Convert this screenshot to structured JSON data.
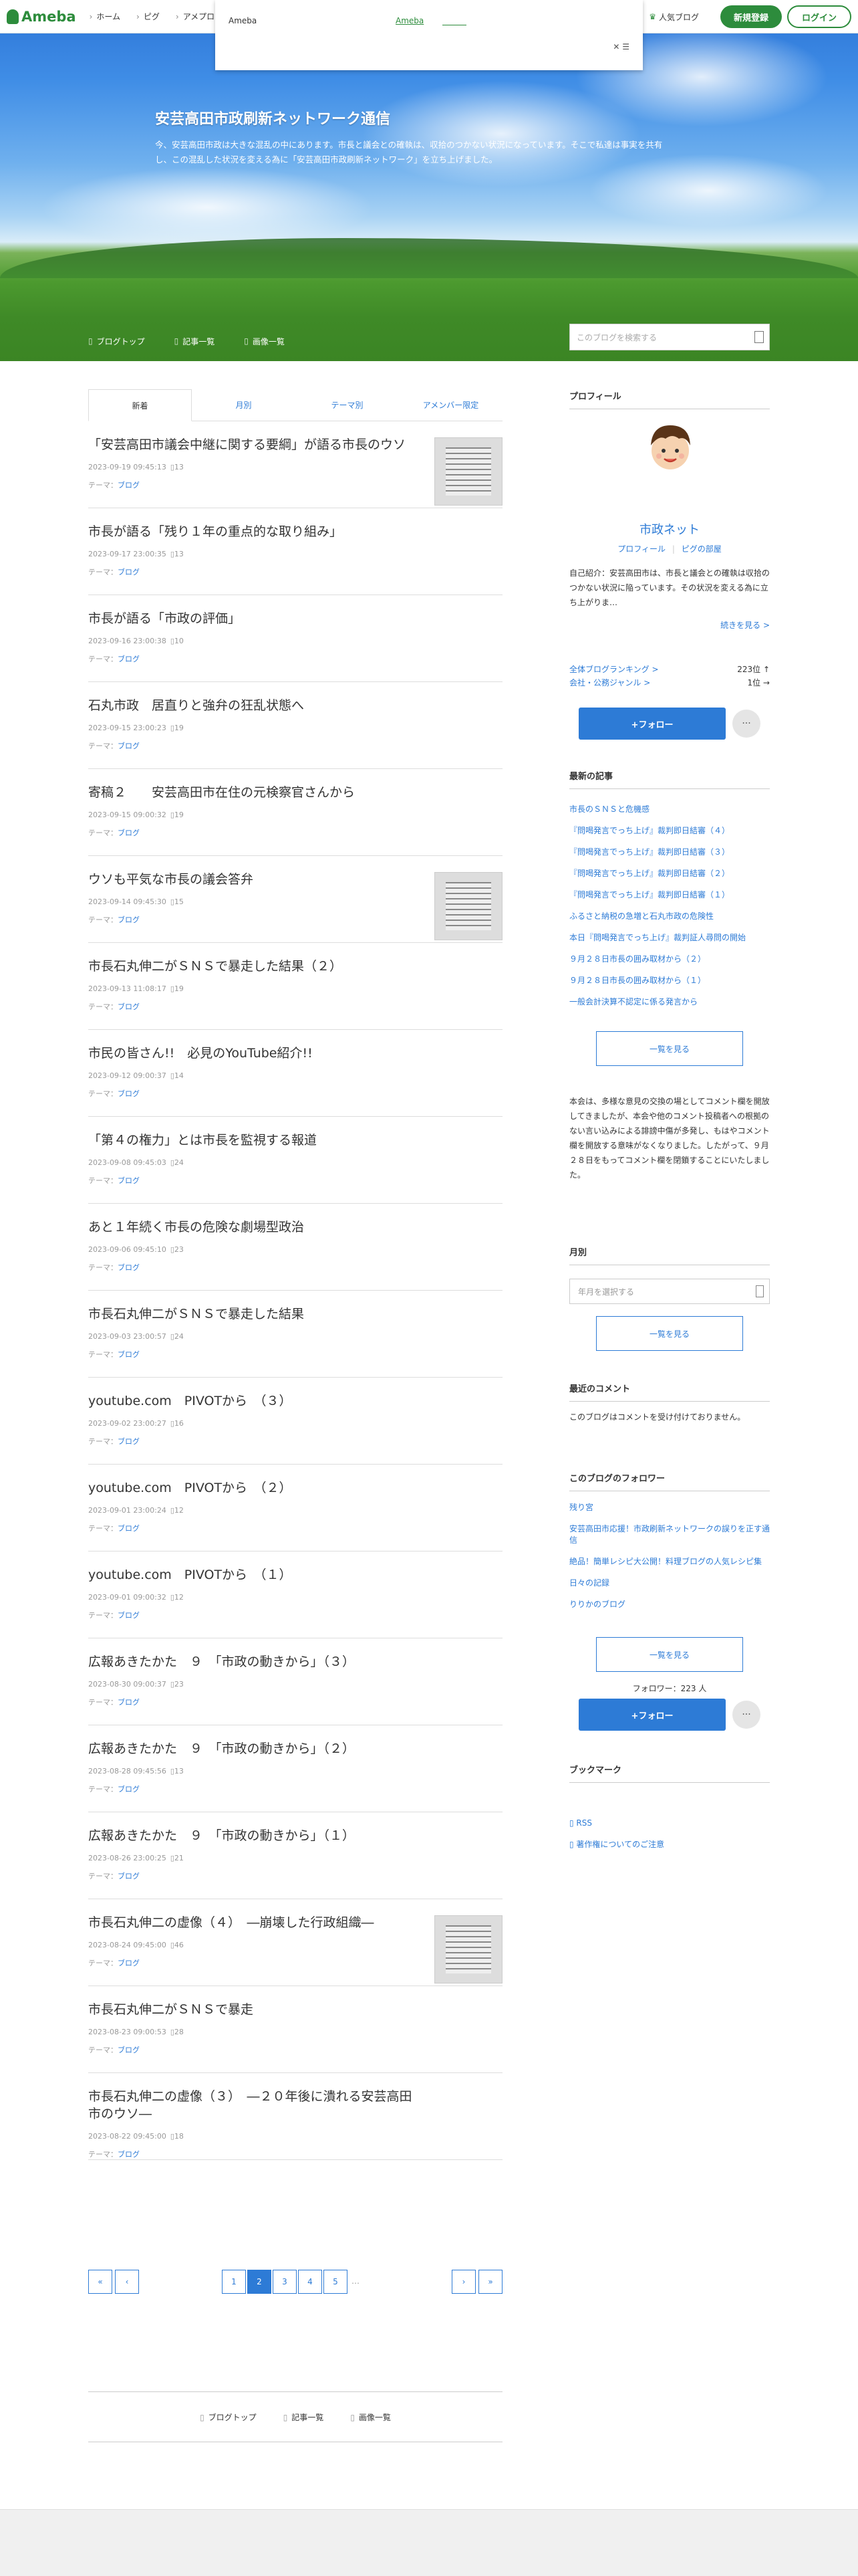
{
  "topbar": {
    "logo": "Ameba",
    "nav": [
      "ホーム",
      "ピグ",
      "アメプロ"
    ],
    "ad": {
      "label": "Ameba",
      "link": "Ameba",
      "close": "✕ ☰"
    },
    "popular_blog": "人気ブログ",
    "register": "新規登録",
    "login": "ログイン"
  },
  "header": {
    "title": "安芸高田市政刷新ネットワーク通信",
    "description": "今、安芸高田市政は大きな混乱の中にあります。市長と議会との確執は、収拾のつかない状況になっています。そこで私達は事実を共有し、この混乱した状況を変える為に「安芸高田市政刷新ネットワーク」を立ち上げました。",
    "nav": [
      "ブログトップ",
      "記事一覧",
      "画像一覧"
    ],
    "search_placeholder": "このブログを検索する"
  },
  "tabs": [
    "新着",
    "月別",
    "テーマ別",
    "アメンバー限定"
  ],
  "entries": [
    {
      "title": "「安芸高田市議会中継に関する要綱」が語る市長のウソ",
      "date": "2023-09-19 09:45:13",
      "comments": "13",
      "theme_label": "テーマ：",
      "theme": "ブログ",
      "thumb": true
    },
    {
      "title": "市長が語る「残り１年の重点的な取り組み」",
      "date": "2023-09-17 23:00:35",
      "comments": "13",
      "theme_label": "テーマ：",
      "theme": "ブログ",
      "thumb": false
    },
    {
      "title": "市長が語る「市政の評価」",
      "date": "2023-09-16 23:00:38",
      "comments": "10",
      "theme_label": "テーマ：",
      "theme": "ブログ",
      "thumb": false
    },
    {
      "title": "石丸市政　居直りと強弁の狂乱状態へ",
      "date": "2023-09-15 23:00:23",
      "comments": "19",
      "theme_label": "テーマ：",
      "theme": "ブログ",
      "thumb": false
    },
    {
      "title": "寄稿２　　安芸高田市在住の元検察官さんから",
      "date": "2023-09-15 09:00:32",
      "comments": "19",
      "theme_label": "テーマ：",
      "theme": "ブログ",
      "thumb": false
    },
    {
      "title": "ウソも平気な市長の議会答弁",
      "date": "2023-09-14 09:45:30",
      "comments": "15",
      "theme_label": "テーマ：",
      "theme": "ブログ",
      "thumb": true
    },
    {
      "title": "市長石丸伸二がＳＮＳで暴走した結果（２）",
      "date": "2023-09-13 11:08:17",
      "comments": "19",
      "theme_label": "テーマ：",
      "theme": "ブログ",
      "thumb": false
    },
    {
      "title": "市民の皆さん!!　必見のYouTube紹介!!",
      "date": "2023-09-12 09:00:37",
      "comments": "14",
      "theme_label": "テーマ：",
      "theme": "ブログ",
      "thumb": false
    },
    {
      "title": "「第４の権力」とは市長を監視する報道",
      "date": "2023-09-08 09:45:03",
      "comments": "24",
      "theme_label": "テーマ：",
      "theme": "ブログ",
      "thumb": false
    },
    {
      "title": "あと１年続く市長の危険な劇場型政治",
      "date": "2023-09-06 09:45:10",
      "comments": "23",
      "theme_label": "テーマ：",
      "theme": "ブログ",
      "thumb": false
    },
    {
      "title": "市長石丸伸二がＳＮＳで暴走した結果",
      "date": "2023-09-03 23:00:57",
      "comments": "24",
      "theme_label": "テーマ：",
      "theme": "ブログ",
      "thumb": false
    },
    {
      "title": "youtube.com　PIVOTから　（３）",
      "date": "2023-09-02 23:00:27",
      "comments": "16",
      "theme_label": "テーマ：",
      "theme": "ブログ",
      "thumb": false
    },
    {
      "title": "youtube.com　PIVOTから　（２）",
      "date": "2023-09-01 23:00:24",
      "comments": "12",
      "theme_label": "テーマ：",
      "theme": "ブログ",
      "thumb": false
    },
    {
      "title": "youtube.com　PIVOTから　（１）",
      "date": "2023-09-01 09:00:32",
      "comments": "12",
      "theme_label": "テーマ：",
      "theme": "ブログ",
      "thumb": false
    },
    {
      "title": "広報あきたかた　９　「市政の動きから」（３）",
      "date": "2023-08-30 09:00:37",
      "comments": "23",
      "theme_label": "テーマ：",
      "theme": "ブログ",
      "thumb": false
    },
    {
      "title": "広報あきたかた　９　「市政の動きから」（２）",
      "date": "2023-08-28 09:45:56",
      "comments": "13",
      "theme_label": "テーマ：",
      "theme": "ブログ",
      "thumb": false
    },
    {
      "title": "広報あきたかた　９　「市政の動きから」（１）",
      "date": "2023-08-26 23:00:25",
      "comments": "21",
      "theme_label": "テーマ：",
      "theme": "ブログ",
      "thumb": false
    },
    {
      "title": "市長石丸伸二の虚像（４）　―崩壊した行政組織―",
      "date": "2023-08-24 09:45:00",
      "comments": "46",
      "theme_label": "テーマ：",
      "theme": "ブログ",
      "thumb": true
    },
    {
      "title": "市長石丸伸二がＳＮＳで暴走",
      "date": "2023-08-23 09:00:53",
      "comments": "28",
      "theme_label": "テーマ：",
      "theme": "ブログ",
      "thumb": false
    },
    {
      "title": "市長石丸伸二の虚像（３）　―２０年後に潰れる安芸高田市のウソ―",
      "date": "2023-08-22 09:45:00",
      "comments": "18",
      "theme_label": "テーマ：",
      "theme": "ブログ",
      "thumb": false
    }
  ],
  "pager": {
    "pages": [
      "1",
      "2",
      "3",
      "4",
      "5"
    ],
    "current": "2",
    "ellipsis": "…"
  },
  "footer_nav": [
    "ブログトップ",
    "記事一覧",
    "画像一覧"
  ],
  "sidebar": {
    "profile": {
      "heading": "プロフィール",
      "name": "市政ネット",
      "link1": "プロフィール",
      "link2": "ピグの部屋",
      "intro": "自己紹介：安芸高田市は、市長と議会との確執は収拾のつかない状況に陥っています。その状況を変える為に立ち上がりま…",
      "more": "続きを見る >",
      "rank1_label": "全体ブログランキング >",
      "rank1_value": "223位 ↑",
      "rank2_label": "会社・公務ジャンル >",
      "rank2_value": "1位 →",
      "follow": "+フォロー",
      "dots": "···"
    },
    "recent": {
      "heading": "最新の記事",
      "items": [
        "市長のＳＮＳと危機感",
        "『問喝発言でっち上げ』裁判即日結審（４）",
        "『問喝発言でっち上げ』裁判即日結審（３）",
        "『問喝発言でっち上げ』裁判即日結審（２）",
        "『問喝発言でっち上げ』裁判即日結審（１）",
        "ふるさと納税の急増と石丸市政の危険性",
        "本日『問喝発言でっち上げ』裁判証人尋問の開始",
        "９月２８日市長の囲み取材から（２）",
        "９月２８日市長の囲み取材から（１）",
        "一般会計決算不認定に係る発言から"
      ],
      "button": "一覧を見る"
    },
    "notice": "本会は、多様な意見の交換の場としてコメント欄を開放してきましたが、本会や他のコメント投稿者への根拠のない言い込みによる誹謗中傷が多発し、もはやコメント欄を開放する意味がなくなりました。したがって、９月２８日をもってコメント欄を閉鎖することにいたしました。",
    "monthly": {
      "heading": "月別",
      "placeholder": "年月を選択する",
      "button": "一覧を見る"
    },
    "comments": {
      "heading": "最近のコメント",
      "text": "このブログはコメントを受け付けておりません。"
    },
    "followers": {
      "heading": "このブログのフォロワー",
      "items": [
        "残り宮",
        "安芸高田市応援！市政刷新ネットワークの誤りを正す通信",
        "絶品！簡単レシピ大公開！料理ブログの人気レシピ集",
        "日々の記録",
        "りりかのブログ"
      ],
      "button": "一覧を見る",
      "count": "フォロワー：223 人",
      "follow": "+フォロー",
      "dots": "···"
    },
    "bookmark": {
      "heading": "ブックマーク",
      "items": [
        "RSS",
        "著作権についてのご注意"
      ]
    }
  }
}
